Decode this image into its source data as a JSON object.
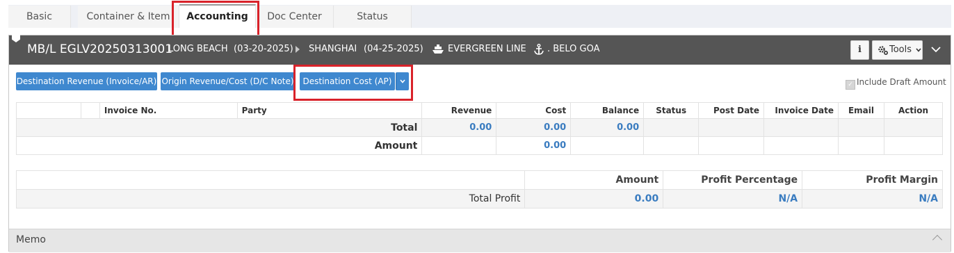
{
  "tabs": [
    {
      "label": "Basic"
    },
    {
      "label": "Container & Item"
    },
    {
      "label": "Accounting"
    },
    {
      "label": "Doc Center"
    },
    {
      "label": "Status"
    }
  ],
  "header": {
    "mbl": "MB/L EGLV20250313001",
    "origin": "LONG BEACH",
    "origin_date": "(03-20-2025)",
    "arrow_icon": "caret-right-icon",
    "destination": "SHANGHAI",
    "destination_date": "(04-25-2025)",
    "carrier_icon": "ship-icon",
    "carrier": "EVERGREEN LINE",
    "vessel_icon": "anchor-icon",
    "vessel": ". BELO GOA",
    "info_label": "i",
    "tools_label": "Tools"
  },
  "actions": {
    "dest_revenue": "Destination Revenue (Invoice/AR)",
    "origin_revenue": "Origin Revenue/Cost (D/C Note)",
    "dest_cost": "Destination Cost (AP)",
    "include_draft": "Include Draft Amount"
  },
  "table": {
    "headers": {
      "invoice_no": "Invoice No.",
      "party": "Party",
      "revenue": "Revenue",
      "cost": "Cost",
      "balance": "Balance",
      "status": "Status",
      "post_date": "Post Date",
      "invoice_date": "Invoice Date",
      "email": "Email",
      "action": "Action"
    },
    "total": {
      "label": "Total",
      "revenue": "0.00",
      "cost": "0.00",
      "balance": "0.00"
    },
    "amount": {
      "label": "Amount",
      "cost": "0.00"
    }
  },
  "profit": {
    "amount_header": "Amount",
    "percentage_header": "Profit Percentage",
    "margin_header": "Profit Margin",
    "label": "Total Profit",
    "amount": "0.00",
    "percentage": "N/A",
    "margin": "N/A"
  },
  "memo": {
    "label": "Memo"
  },
  "colors": {
    "accent": "#3f88cf",
    "header_bg": "#555555",
    "highlight": "#d9222a"
  }
}
